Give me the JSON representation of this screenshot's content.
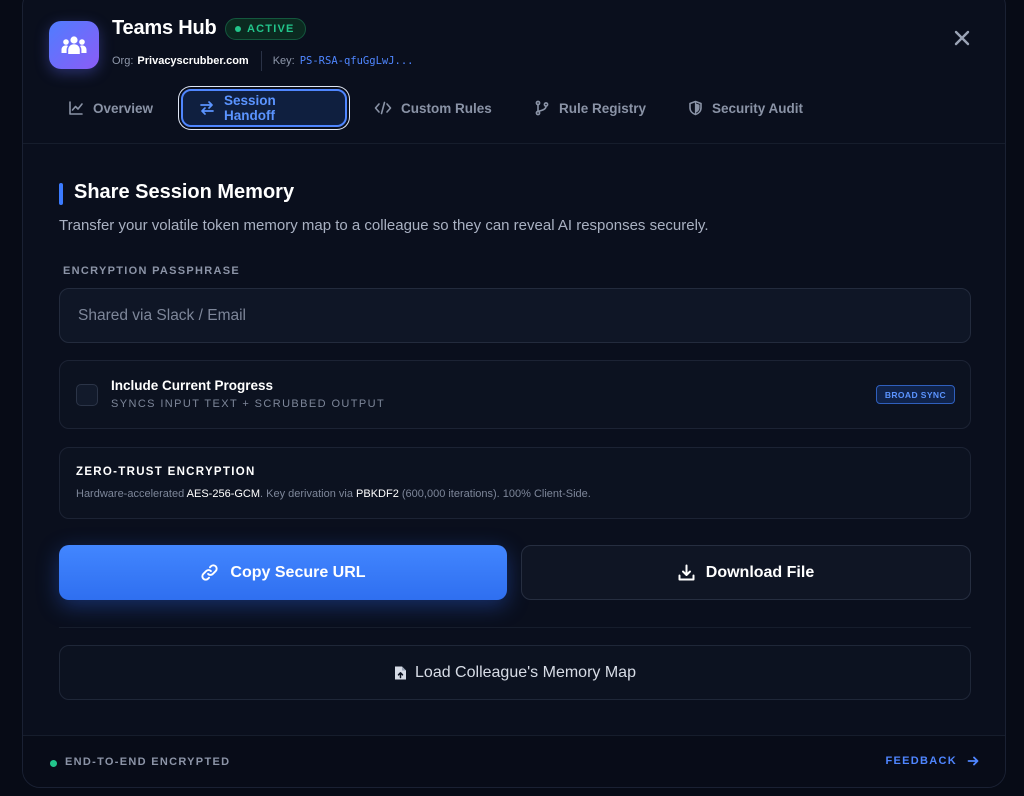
{
  "header": {
    "title": "Teams Hub",
    "status": "ACTIVE",
    "org_label": "Org:",
    "org_value": "Privacyscrubber.com",
    "key_label": "Key:",
    "key_value": "PS-RSA-qfuGgLwJ..."
  },
  "tabs": [
    {
      "label": "Overview",
      "icon": "chart-line-icon",
      "active": false
    },
    {
      "label": "Session Handoff",
      "icon": "swap-arrows-icon",
      "active": true
    },
    {
      "label": "Custom Rules",
      "icon": "code-icon",
      "active": false
    },
    {
      "label": "Rule Registry",
      "icon": "git-branch-icon",
      "active": false
    },
    {
      "label": "Security Audit",
      "icon": "shield-icon",
      "active": false
    }
  ],
  "section": {
    "title": "Share Session Memory",
    "description": "Transfer your volatile token memory map to a colleague so they can reveal AI responses securely."
  },
  "passphrase": {
    "label": "ENCRYPTION PASSPHRASE",
    "placeholder": "Shared via Slack / Email",
    "value": ""
  },
  "progress_option": {
    "title": "Include Current Progress",
    "subtitle": "SYNCS INPUT TEXT + SCRUBBED OUTPUT",
    "badge": "BROAD SYNC",
    "checked": false
  },
  "encryption": {
    "title": "ZERO-TRUST ENCRYPTION",
    "desc_prefix": "Hardware-accelerated ",
    "algo": "AES-256-GCM",
    "desc_mid": ". Key derivation via ",
    "kdf": "PBKDF2",
    "desc_suffix": " (600,000 iterations). 100% Client-Side."
  },
  "actions": {
    "copy_label": "Copy Secure URL",
    "download_label": "Download File",
    "load_label": "Load Colleague's Memory Map"
  },
  "footer": {
    "status": "END-TO-END ENCRYPTED",
    "feedback": "FEEDBACK"
  },
  "colors": {
    "accent": "#3b7bff",
    "success": "#22c58b",
    "background": "#070b16",
    "panel": "#0a0f1d"
  }
}
